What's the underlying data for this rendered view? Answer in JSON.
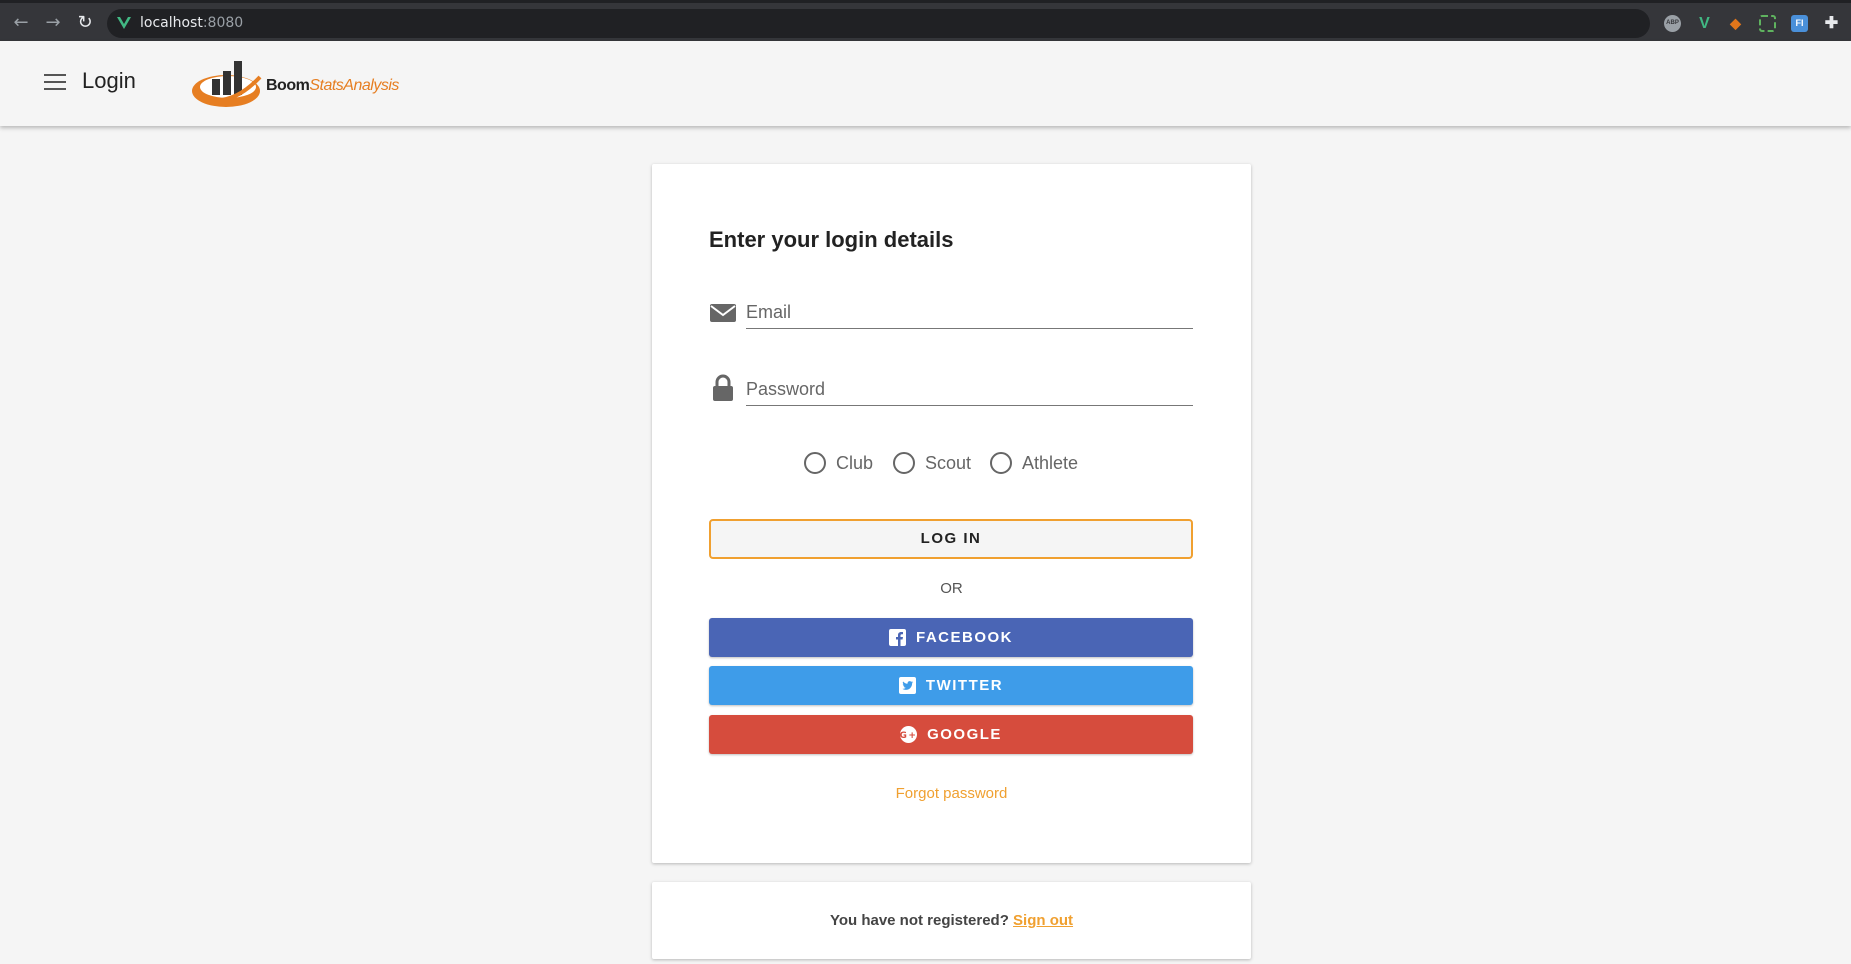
{
  "browser": {
    "url_host": "localhost",
    "url_port": ":8080",
    "extensions": [
      "adblock-icon",
      "vue-devtools-icon",
      "metamask-icon",
      "selection-icon",
      "fi-extension-icon",
      "extensions-puzzle-icon"
    ]
  },
  "app_bar": {
    "title": "Login",
    "logo_text_main": "Boom",
    "logo_text_accent": "StatsAnalysis"
  },
  "login_card": {
    "heading": "Enter your login details",
    "email_placeholder": "Email",
    "password_placeholder": "Password",
    "roles": [
      "Club",
      "Scout",
      "Athlete"
    ],
    "login_label": "LOG IN",
    "or_label": "OR",
    "facebook_label": "FACEBOOK",
    "twitter_label": "TWITTER",
    "google_label": "GOOGLE",
    "forgot_label": "Forgot password"
  },
  "register_card": {
    "text": "You have not registered?",
    "link_label": "Sign out"
  },
  "colors": {
    "accent": "#f0a030",
    "facebook": "#4a65b5",
    "twitter": "#3e9ce9",
    "google": "#d64c3d"
  }
}
